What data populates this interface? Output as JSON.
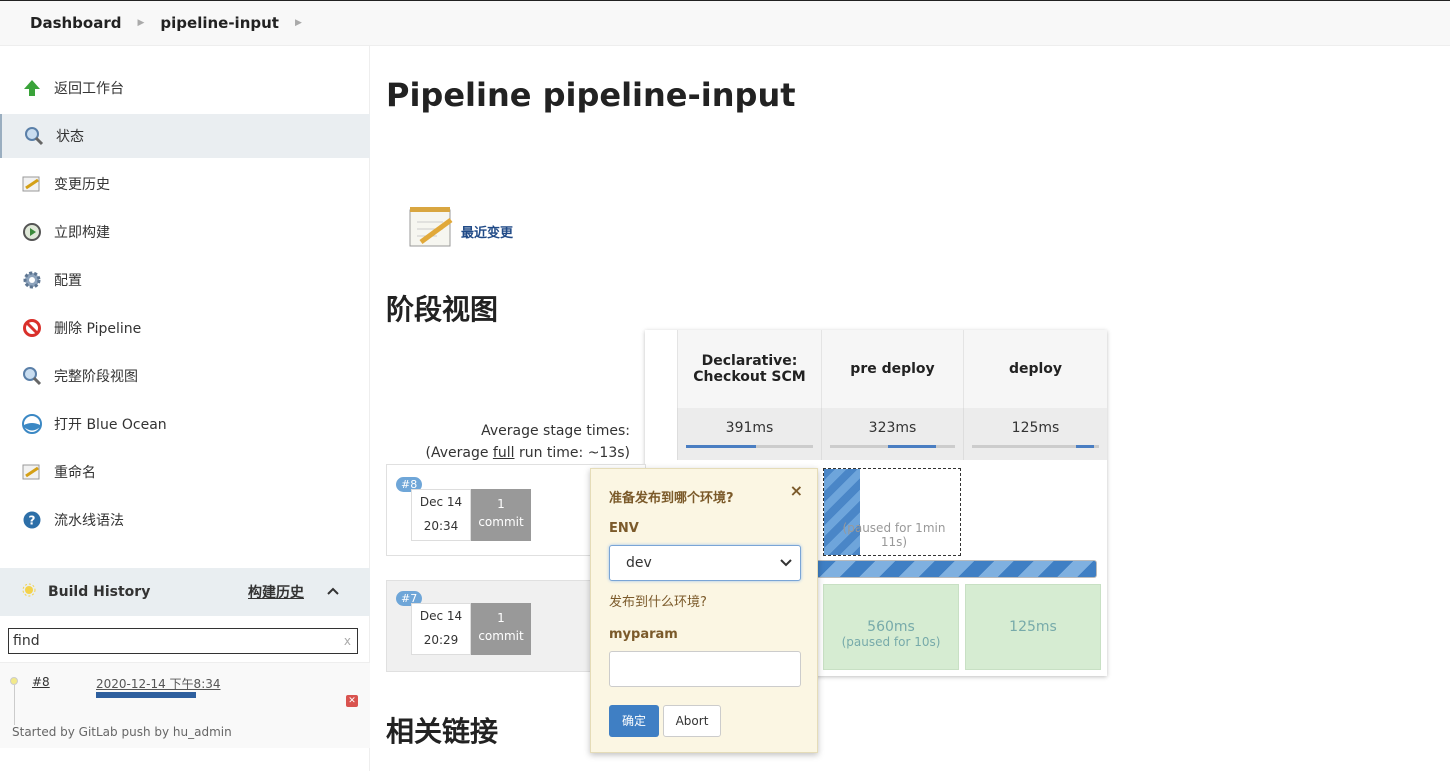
{
  "breadcrumb": {
    "items": [
      "Dashboard",
      "pipeline-input"
    ]
  },
  "sidebar": {
    "tasks": [
      {
        "label": "返回工作台",
        "icon": "up-arrow-icon"
      },
      {
        "label": "状态",
        "icon": "search-icon"
      },
      {
        "label": "变更历史",
        "icon": "notepad-icon"
      },
      {
        "label": "立即构建",
        "icon": "build-clock-icon"
      },
      {
        "label": "配置",
        "icon": "gear-icon"
      },
      {
        "label": "删除 Pipeline",
        "icon": "no-entry-icon"
      },
      {
        "label": "完整阶段视图",
        "icon": "search-icon"
      },
      {
        "label": "打开 Blue Ocean",
        "icon": "blue-ocean-icon"
      },
      {
        "label": "重命名",
        "icon": "notepad-icon"
      },
      {
        "label": "流水线语法",
        "icon": "help-icon"
      }
    ],
    "active_index": 1
  },
  "build_history": {
    "title": "Build History",
    "link": "构建历史",
    "caret": "^",
    "search_value": "find",
    "clear": "x",
    "builds": [
      {
        "number": "#8",
        "date": "2020-12-14 下午8:34",
        "started_by": "Started by GitLab push by hu_admin"
      }
    ]
  },
  "main": {
    "title": "Pipeline pipeline-input",
    "recent_changes": "最近变更",
    "stage_view_heading": "阶段视图",
    "related_links_heading": "相关链接"
  },
  "stage_view": {
    "stages": [
      "Declarative: Checkout SCM",
      "pre deploy",
      "deploy"
    ],
    "average_label": "Average stage times:",
    "average_full_prefix": "(Average ",
    "average_full_link": "full",
    "average_full_suffix": " run time: ~13s)",
    "averages": [
      "391ms",
      "323ms",
      "125ms"
    ],
    "runs": [
      {
        "badge": "#8",
        "date": "Dec 14",
        "time": "20:34",
        "commits": "1",
        "commit_label": "commit",
        "pre_deploy": "(paused for 1min 11s)"
      },
      {
        "badge": "#7",
        "date": "Dec 14",
        "time": "20:29",
        "commits": "1",
        "commit_label": "commit",
        "pre_deploy": "560ms",
        "pre_deploy_note": "(paused for 10s)",
        "deploy": "125ms"
      }
    ]
  },
  "input_popover": {
    "title": "准备发布到哪个环境?",
    "close": "×",
    "env_label": "ENV",
    "env_value": "dev",
    "env_help": "发布到什么环境?",
    "myparam_label": "myparam",
    "ok_label": "确定",
    "abort_label": "Abort"
  },
  "colors": {
    "accent": "#3f7fc4",
    "popover_bg": "#fbf6e3",
    "success": "#d6ecd2"
  }
}
